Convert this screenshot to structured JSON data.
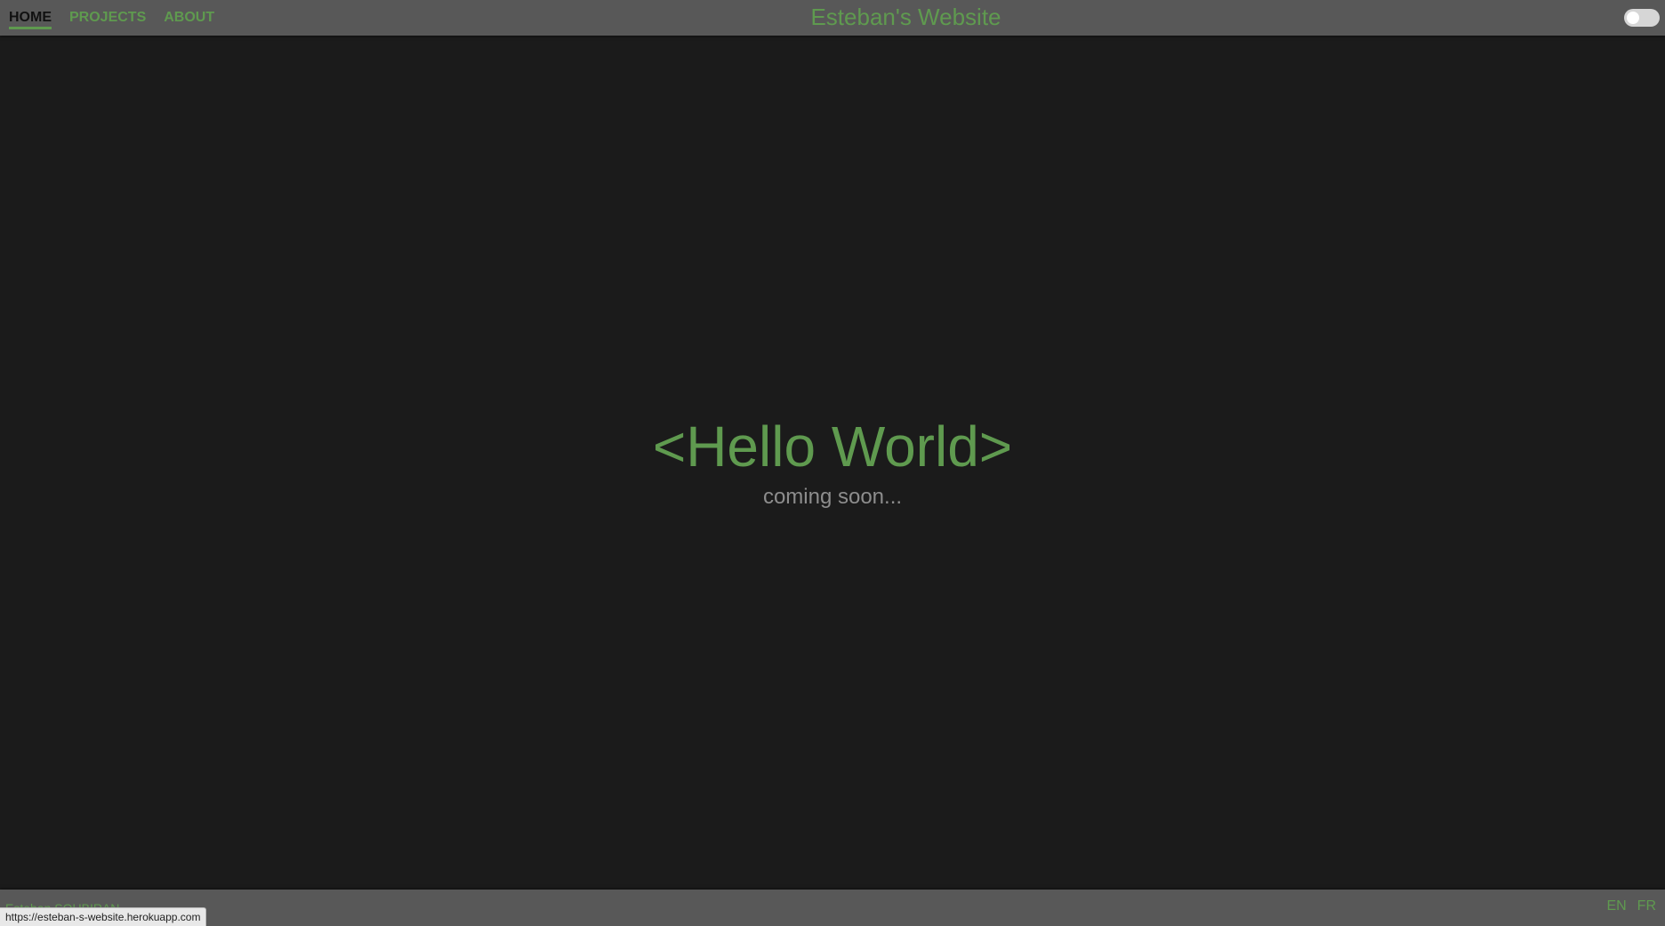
{
  "header": {
    "nav": [
      {
        "label": "HOME",
        "active": true
      },
      {
        "label": "PROJECTS",
        "active": false
      },
      {
        "label": "ABOUT",
        "active": false
      }
    ],
    "site_title": "Esteban's Website",
    "theme_toggle": {
      "icon": "theme-toggle-switch",
      "state": "off"
    }
  },
  "main": {
    "title": "<Hello World>",
    "subtitle": "coming soon..."
  },
  "footer": {
    "author": "Esteban SOUBIRAN",
    "languages": [
      "EN",
      "FR"
    ]
  },
  "status_bar": {
    "url": "https://esteban-s-website.herokuapp.com"
  },
  "colors": {
    "background": "#1b1b1b",
    "bar": "#585858",
    "accent_green": "#5f9a4f",
    "muted_text": "#8d8d8d"
  }
}
